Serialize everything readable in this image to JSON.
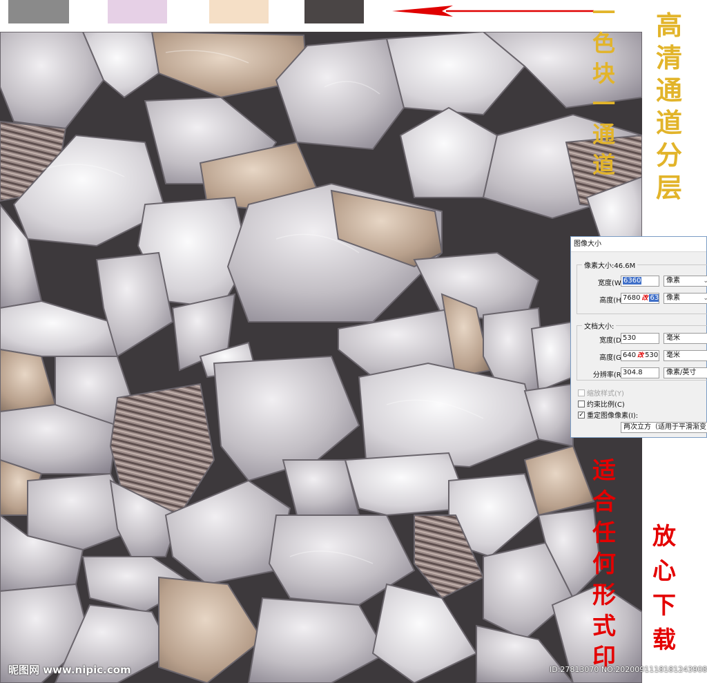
{
  "swatches": [
    {
      "name": "gray",
      "color": "#8a8a8a"
    },
    {
      "name": "lavender",
      "color": "#e6d0e6"
    },
    {
      "name": "peach",
      "color": "#f5dfc6"
    },
    {
      "name": "charcoal",
      "color": "#4a4545"
    }
  ],
  "arrow": {
    "icon": "red-left-arrow-icon",
    "color": "#e00000"
  },
  "labels": {
    "gold_left": [
      "一",
      "色",
      "块",
      "一",
      "通",
      "道"
    ],
    "gold_right": [
      "高",
      "清",
      "通",
      "道",
      "分",
      "层"
    ],
    "red_left": [
      "适",
      "合",
      "任",
      "何",
      "形",
      "式",
      "印"
    ],
    "red_right": [
      "放",
      "心",
      "下",
      "载"
    ]
  },
  "dialog": {
    "title": "图像大小",
    "pixel_size": "像素大小:46.6M",
    "width_label": "宽度(W):",
    "width_value": "6360",
    "height_label": "高度(H):",
    "height_old": "7680",
    "height_mark": "改",
    "height_value": "6360",
    "pixel_unit": "像素",
    "doc_size": "文档大小:",
    "doc_width_label": "宽度(D):",
    "doc_width_value": "530",
    "doc_height_label": "高度(G):",
    "doc_height_old": "640",
    "doc_height_mark": "改",
    "doc_height_value": "530",
    "mm_unit": "毫米",
    "resolution_label": "分辨率(R):",
    "resolution_value": "304.8",
    "resolution_unit": "像素/英寸",
    "scale_styles": "缩放样式(Y)",
    "constrain": "约束比例(C)",
    "resample": "重定图像像素(I):",
    "resample_method": "两次立方（适用于平滑渐变"
  },
  "watermark": {
    "left": "昵图网 www.nipic.com",
    "right": "ID:27813070 NO:20200911181812439080"
  }
}
